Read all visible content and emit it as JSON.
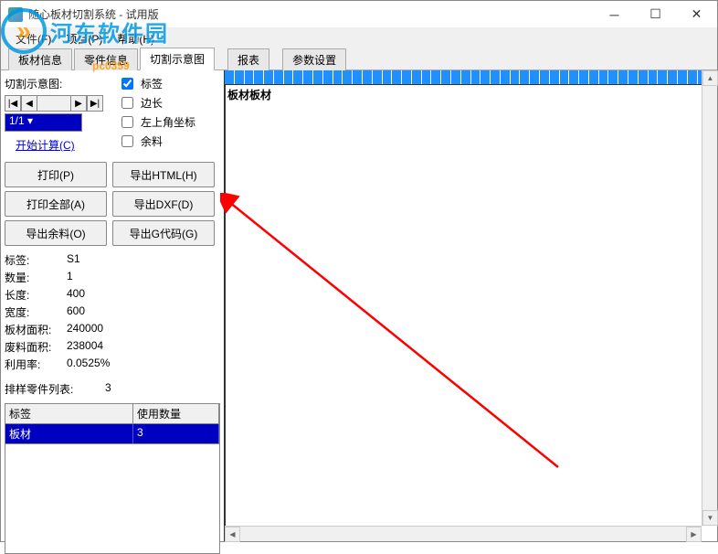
{
  "window": {
    "title": "随心板材切割系统 - 试用版"
  },
  "watermark": {
    "text": "河东软件园",
    "sub": "pc0359"
  },
  "menu": {
    "file": "文件(F)",
    "project": "项目(P)",
    "help": "帮助(H)"
  },
  "tabs": {
    "t1": "板材信息",
    "t2": "零件信息",
    "t3": "切割示意图",
    "t4": "报表",
    "t5": "参数设置"
  },
  "panel": {
    "section_title": "切割示意图:",
    "checkboxes": {
      "label": "标签",
      "edge": "边长",
      "coord": "左上角坐标",
      "scrap": "余料"
    },
    "page_selector": "1/1",
    "calc_link": "开始计算(C)",
    "buttons": {
      "print": "打印(P)",
      "print_all": "打印全部(A)",
      "export_scrap": "导出余料(O)",
      "export_html": "导出HTML(H)",
      "export_dxf": "导出DXF(D)",
      "export_gcode": "导出G代码(G)"
    },
    "info": {
      "label_k": "标签:",
      "label_v": "S1",
      "qty_k": "数量:",
      "qty_v": "1",
      "len_k": "长度:",
      "len_v": "400",
      "wid_k": "宽度:",
      "wid_v": "600",
      "area_k": "板材面积:",
      "area_v": "240000",
      "waste_k": "废料面积:",
      "waste_v": "238004",
      "util_k": "利用率:",
      "util_v": "0.0525%",
      "parts_k": "排样零件列表:",
      "parts_v": "3"
    },
    "table": {
      "h1": "标签",
      "h2": "使用数量",
      "r1c1": "板材",
      "r1c2": "3"
    }
  },
  "diagram": {
    "label": "板材板材"
  }
}
